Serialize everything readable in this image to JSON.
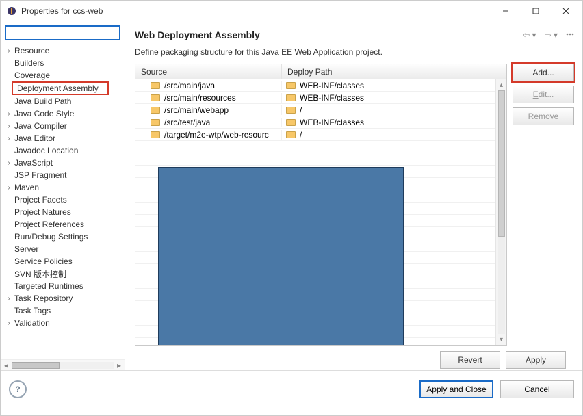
{
  "window": {
    "title": "Properties for ccs-web"
  },
  "sidebar": {
    "items": [
      {
        "label": "Resource",
        "expandable": true
      },
      {
        "label": "Builders",
        "expandable": false
      },
      {
        "label": "Coverage",
        "expandable": false
      },
      {
        "label": "Deployment Assembly",
        "expandable": false,
        "selected": true
      },
      {
        "label": "Java Build Path",
        "expandable": false
      },
      {
        "label": "Java Code Style",
        "expandable": true
      },
      {
        "label": "Java Compiler",
        "expandable": true
      },
      {
        "label": "Java Editor",
        "expandable": true
      },
      {
        "label": "Javadoc Location",
        "expandable": false
      },
      {
        "label": "JavaScript",
        "expandable": true
      },
      {
        "label": "JSP Fragment",
        "expandable": false
      },
      {
        "label": "Maven",
        "expandable": true
      },
      {
        "label": "Project Facets",
        "expandable": false
      },
      {
        "label": "Project Natures",
        "expandable": false
      },
      {
        "label": "Project References",
        "expandable": false
      },
      {
        "label": "Run/Debug Settings",
        "expandable": false
      },
      {
        "label": "Server",
        "expandable": false
      },
      {
        "label": "Service Policies",
        "expandable": false
      },
      {
        "label": "SVN 版本控制",
        "expandable": false
      },
      {
        "label": "Targeted Runtimes",
        "expandable": false
      },
      {
        "label": "Task Repository",
        "expandable": true
      },
      {
        "label": "Task Tags",
        "expandable": false
      },
      {
        "label": "Validation",
        "expandable": true
      }
    ]
  },
  "page": {
    "heading": "Web Deployment Assembly",
    "description": "Define packaging structure for this Java EE Web Application project.",
    "columns": {
      "source": "Source",
      "deploy": "Deploy Path"
    },
    "rows": [
      {
        "source": "/src/main/java",
        "deploy": "WEB-INF/classes"
      },
      {
        "source": "/src/main/resources",
        "deploy": "WEB-INF/classes"
      },
      {
        "source": "/src/main/webapp",
        "deploy": "/"
      },
      {
        "source": "/src/test/java",
        "deploy": "WEB-INF/classes"
      },
      {
        "source": "/target/m2e-wtp/web-resourc",
        "deploy": "/"
      }
    ]
  },
  "buttons": {
    "add": "Add...",
    "edit": "Edit...",
    "remove": "Remove",
    "revert": "Revert",
    "apply": "Apply",
    "apply_close": "Apply and Close",
    "cancel": "Cancel"
  }
}
